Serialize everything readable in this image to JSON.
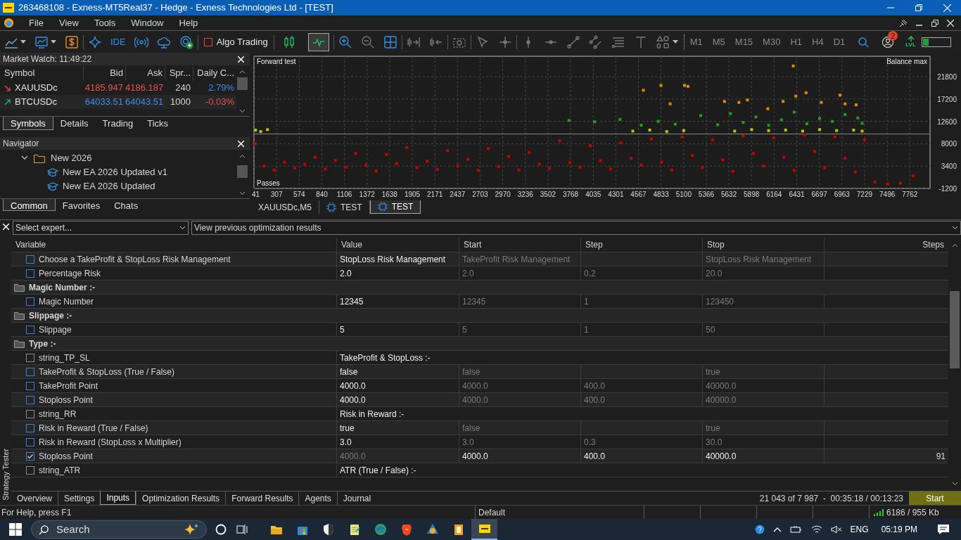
{
  "window": {
    "title": "263468108 - Exness-MT5Real37 - Hedge - Exness Technologies Ltd - [TEST]"
  },
  "menu": [
    "File",
    "View",
    "Tools",
    "Window",
    "Help"
  ],
  "toolbar": [
    [
      {
        "kind": "line-dropdown"
      },
      {
        "kind": "window-dropdown"
      },
      {
        "kind": "dollar"
      }
    ],
    [
      {
        "kind": "sparkle"
      },
      {
        "kind": "text",
        "label": "IDE"
      },
      {
        "kind": "broadcast"
      },
      {
        "kind": "cloud"
      },
      {
        "kind": "globe-plus"
      }
    ],
    [
      {
        "kind": "toggle",
        "label": "Algo Trading",
        "on": false
      }
    ],
    [
      {
        "kind": "candles",
        "selected": false
      },
      {
        "kind": "line",
        "selected": true
      }
    ],
    [
      {
        "kind": "zoom-in"
      },
      {
        "kind": "zoom-out"
      },
      {
        "kind": "grid"
      }
    ],
    [
      {
        "kind": "shift"
      },
      {
        "kind": "autoscroll"
      }
    ],
    [
      {
        "kind": "camera"
      }
    ],
    [
      {
        "kind": "cursor"
      },
      {
        "kind": "crosshair"
      }
    ],
    [
      {
        "kind": "vline"
      },
      {
        "kind": "hline"
      },
      {
        "kind": "trend"
      },
      {
        "kind": "channel"
      },
      {
        "kind": "fibo"
      },
      {
        "kind": "text-tool"
      },
      {
        "kind": "shapes"
      }
    ]
  ],
  "timeframes": [
    "M1",
    "M5",
    "M15",
    "M30",
    "H1",
    "H4",
    "D1"
  ],
  "toolbar_right": {
    "notifications": "2",
    "level_label": "LVL",
    "meter": {
      "level": 0.22
    }
  },
  "market_watch": {
    "title": "Market Watch: 11:49:22",
    "columns": [
      "Symbol",
      "Bid",
      "Ask",
      "Spr...",
      "Daily C..."
    ],
    "rows": [
      {
        "symbol": "XAUUSDc",
        "rising": false,
        "bid": "4185.947",
        "ask": "4186.187",
        "spread": "240",
        "daily_change": "2.79%",
        "change_positive": true
      },
      {
        "symbol": "BTCUSDc",
        "rising": true,
        "bid": "64033.51",
        "ask": "64043.51",
        "spread": "1000",
        "daily_change": "-0.03%",
        "change_positive": false
      }
    ],
    "tabs": [
      {
        "label": "Symbols",
        "selected": true
      },
      {
        "label": "Details",
        "selected": false
      },
      {
        "label": "Trading",
        "selected": false
      },
      {
        "label": "Ticks",
        "selected": false
      }
    ]
  },
  "navigator": {
    "title": "Navigator",
    "tree": [
      {
        "label": "New 2026",
        "expanded": true,
        "children": [
          {
            "label": "New EA 2026 Updated v1"
          },
          {
            "label": "New EA 2026 Updated"
          }
        ]
      }
    ],
    "tabs": [
      {
        "label": "Common",
        "selected": true
      },
      {
        "label": "Favorites",
        "selected": false
      },
      {
        "label": "Chats",
        "selected": false
      }
    ]
  },
  "chart": {
    "chart_data": {
      "type": "scatter",
      "title": "Forward test",
      "ylabel": "Balance max",
      "xlabel": "Passes",
      "xlim": [
        41,
        8000
      ],
      "ylim": [
        -1200,
        26000
      ],
      "xticks": [
        41,
        307,
        574,
        840,
        1106,
        1372,
        1638,
        1905,
        2171,
        2437,
        2703,
        2970,
        3236,
        3502,
        3768,
        4035,
        4301,
        4567,
        4833,
        5100,
        5366,
        5632,
        5898,
        6164,
        6431,
        6697,
        6963,
        7229,
        7496,
        7762
      ],
      "yticks": [
        -1200,
        3400,
        8000,
        12600,
        17200,
        21800
      ],
      "grid": true,
      "ref_lines": [
        {
          "axis": "y",
          "value": 10000
        }
      ],
      "series": [
        {
          "color": "#cc0000",
          "x": [
            41,
            160,
            280,
            400,
            520,
            640,
            760,
            880,
            1000,
            1120,
            1240,
            1360,
            1480,
            1600,
            1720,
            1840,
            1960,
            2080,
            2200,
            2320,
            2440,
            2560,
            2680,
            2800,
            2920,
            3040,
            3160,
            3280,
            3400,
            3520,
            3640,
            3760,
            3880,
            4000,
            4120,
            4240,
            4360,
            4480,
            4600,
            4720,
            4840,
            4960,
            5080,
            5200,
            5320,
            5440,
            5560,
            5680,
            5800,
            5920,
            6040,
            6160,
            6280,
            6400,
            6520,
            6640,
            6760,
            6880,
            7000,
            7120,
            7229,
            7350,
            7500,
            7650,
            7800
          ],
          "values": [
            8000,
            3400,
            2600,
            4200,
            3000,
            3800,
            5200,
            2800,
            4600,
            3200,
            6000,
            3600,
            2400,
            5800,
            3900,
            7200,
            3100,
            4400,
            2700,
            6600,
            3500,
            4800,
            2500,
            7000,
            3300,
            5400,
            2600,
            6200,
            3800,
            2900,
            8600,
            4100,
            3200,
            7600,
            4500,
            2800,
            8200,
            5000,
            3600,
            9000,
            4200,
            2600,
            9400,
            5600,
            3100,
            8800,
            4700,
            2300,
            9600,
            6000,
            3400,
            9200,
            5200,
            2500,
            9800,
            6400,
            3000,
            9400,
            5000,
            2200,
            8800,
            100,
            -300,
            -100,
            1400
          ]
        },
        {
          "color": "#b8c400",
          "x": [
            60,
            120,
            200,
            4500,
            4700,
            4900,
            5100,
            5700,
            5900,
            6100,
            6300,
            6500,
            6700,
            6900,
            7100,
            7200
          ],
          "values": [
            10800,
            10500,
            10900,
            10600,
            10800,
            10500,
            10700,
            10600,
            10900,
            10700,
            10800,
            10600,
            10900,
            10700,
            10800,
            10600
          ]
        },
        {
          "color": "#1f9e1f",
          "x": [
            3750,
            4050,
            4350,
            4600,
            4800,
            5000,
            5300,
            5500,
            5650,
            5800,
            5950,
            6100,
            6250,
            6400,
            6550,
            6700,
            6850,
            7000,
            7150,
            7200
          ],
          "values": [
            12800,
            12500,
            13000,
            11800,
            12600,
            12000,
            13800,
            11900,
            14200,
            12400,
            13500,
            11800,
            12900,
            14500,
            12100,
            13200,
            12600,
            14000,
            13300,
            12200
          ]
        },
        {
          "color": "#e08a00",
          "x": [
            4626,
            4833,
            4940,
            5110,
            5150,
            5580,
            5750,
            5850,
            6090,
            6270,
            6390,
            6420,
            6540,
            6720,
            6940,
            7000,
            7130
          ],
          "values": [
            19000,
            20000,
            16200,
            20000,
            19800,
            16700,
            16500,
            17000,
            15200,
            16700,
            24000,
            17800,
            18500,
            16500,
            18000,
            16200,
            16000
          ]
        }
      ]
    },
    "tabs": [
      {
        "label": "XAUUSDc,M5",
        "kind": "chart",
        "selected": false
      },
      {
        "label": "TEST",
        "kind": "tester",
        "selected": false
      },
      {
        "label": "TEST",
        "kind": "tester",
        "selected": true
      }
    ]
  },
  "tester": {
    "title": "Strategy Tester",
    "expert_placeholder": "Select expert...",
    "results_select": "View previous optimization results",
    "columns": [
      "Variable",
      "Value",
      "Start",
      "Step",
      "Stop",
      "Steps"
    ],
    "rows": [
      {
        "kind": "param",
        "variable": "Choose a TakeProfit & StopLoss Risk Management",
        "checked": false,
        "value": "StopLoss Risk Management",
        "start": "TakeProfit Risk Management",
        "stop": "StopLoss Risk Management"
      },
      {
        "kind": "param",
        "variable": "Percentage Risk",
        "checked": false,
        "value": "2.0",
        "start": "2.0",
        "step": "0.2",
        "stop": "20.0"
      },
      {
        "kind": "group",
        "variable": "Magic Number :-"
      },
      {
        "kind": "param",
        "variable": "Magic Number",
        "checked": false,
        "value": "12345",
        "start": "12345",
        "step": "1",
        "stop": "123450"
      },
      {
        "kind": "group",
        "variable": "Slippage :-"
      },
      {
        "kind": "param",
        "variable": "Slippage",
        "checked": false,
        "value": "5",
        "start": "5",
        "step": "1",
        "stop": "50"
      },
      {
        "kind": "group",
        "variable": "Type :-"
      },
      {
        "kind": "string",
        "variable": "string_TP_SL",
        "checked": false,
        "value": "TakeProfit & StopLoss :-"
      },
      {
        "kind": "param",
        "variable": "TakeProfit & StopLoss (True / False)",
        "checked": false,
        "value": "false",
        "start": "false",
        "stop": "true"
      },
      {
        "kind": "param",
        "variable": "TakeProfit Point",
        "checked": false,
        "value": "4000.0",
        "start": "4000.0",
        "step": "400.0",
        "stop": "40000.0"
      },
      {
        "kind": "param",
        "variable": "Stoploss Point",
        "checked": false,
        "value": "4000.0",
        "start": "4000.0",
        "step": "400.0",
        "stop": "40000.0"
      },
      {
        "kind": "string",
        "variable": "string_RR",
        "checked": false,
        "value": "Risk in Reward :-"
      },
      {
        "kind": "param",
        "variable": "Risk in Reward (True / False)",
        "checked": false,
        "value": "true",
        "start": "false",
        "stop": "true"
      },
      {
        "kind": "param",
        "variable": "Risk in Reward (StopLoss x Multiplier)",
        "checked": false,
        "value": "3.0",
        "start": "3.0",
        "step": "0.3",
        "stop": "30.0"
      },
      {
        "kind": "param",
        "variable": "Stoploss Point",
        "checked": true,
        "value": "4000.0",
        "start": "4000.0",
        "step": "400.0",
        "stop": "40000.0",
        "steps": "91"
      },
      {
        "kind": "string",
        "variable": "string_ATR",
        "checked": false,
        "value": "ATR (True / False) :-"
      }
    ],
    "tabs": [
      {
        "label": "Overview",
        "selected": false
      },
      {
        "label": "Settings",
        "selected": false
      },
      {
        "label": "Inputs",
        "selected": true
      },
      {
        "label": "Optimization Results",
        "selected": false
      },
      {
        "label": "Forward Results",
        "selected": false
      },
      {
        "label": "Agents",
        "selected": false
      },
      {
        "label": "Journal",
        "selected": false
      }
    ],
    "progress": "21 043 of 7 987  -  00:35:18 / 00:13:23",
    "start_button": "Start"
  },
  "status_bar": {
    "help": "For Help, press F1",
    "profile": "Default",
    "traffic": "6186 / 955 Kb"
  },
  "taskbar": {
    "search_placeholder": "Search",
    "apps": [
      {
        "kind": "explorer",
        "active": false
      },
      {
        "kind": "store",
        "active": false
      },
      {
        "kind": "shield",
        "active": false
      },
      {
        "kind": "notepad",
        "active": false
      },
      {
        "kind": "edge",
        "active": false
      },
      {
        "kind": "brave",
        "active": false
      },
      {
        "kind": "mt5",
        "active": false
      },
      {
        "kind": "app",
        "active": false
      },
      {
        "kind": "exness",
        "active": true
      }
    ],
    "language": "ENG",
    "time": "05:19 PM"
  }
}
